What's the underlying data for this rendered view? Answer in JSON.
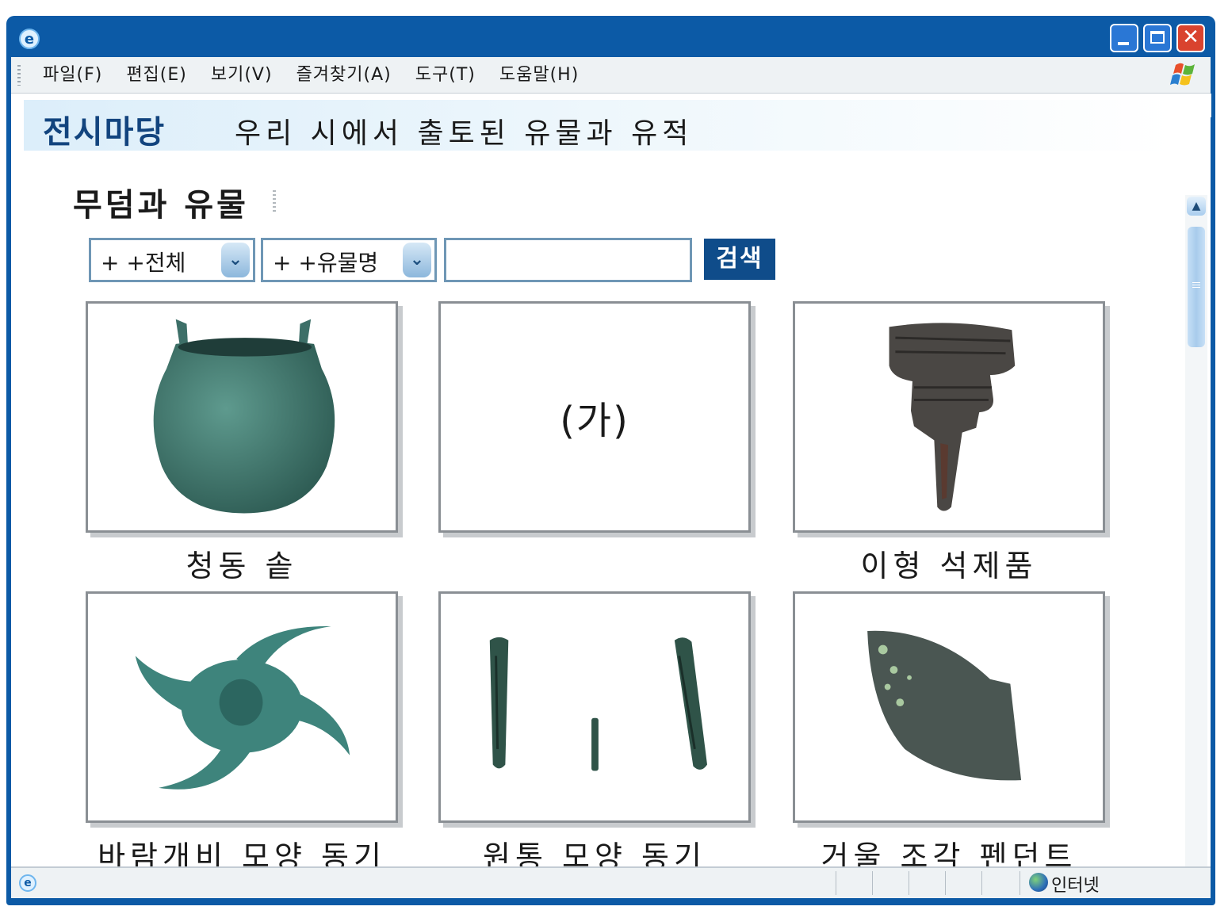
{
  "menu": {
    "items": [
      "파일(F)",
      "편집(E)",
      "보기(V)",
      "즐겨찾기(A)",
      "도구(T)",
      "도움말(H)"
    ]
  },
  "banner": {
    "title": "전시마당",
    "subtitle": "우리 시에서 출토된 유물과 유적"
  },
  "section": {
    "title": "무덤과 유물"
  },
  "search": {
    "category_value": "+ +전체",
    "field_value": "+ +유물명",
    "input_value": "",
    "button_label": "검색"
  },
  "artifacts": [
    {
      "caption": "청동 솥",
      "image": "bronze-cauldron",
      "placeholder": ""
    },
    {
      "caption": "",
      "image": "",
      "placeholder": "(가)"
    },
    {
      "caption": "이형 석제품",
      "image": "stepped-stone-artifact",
      "placeholder": ""
    },
    {
      "caption": "바람개비 모양 동기",
      "image": "pinwheel-bronze",
      "placeholder": ""
    },
    {
      "caption": "원통 모양 동기",
      "image": "cylindrical-bronze",
      "placeholder": ""
    },
    {
      "caption": "거울 조각 펜던트",
      "image": "mirror-fragment-pendant",
      "placeholder": ""
    }
  ],
  "status": {
    "zone": "인터넷"
  },
  "colors": {
    "window_frame": "#0c5aa6",
    "banner_title": "#12447e",
    "search_button": "#0f4c8a",
    "bronze": "#3f7a72"
  }
}
